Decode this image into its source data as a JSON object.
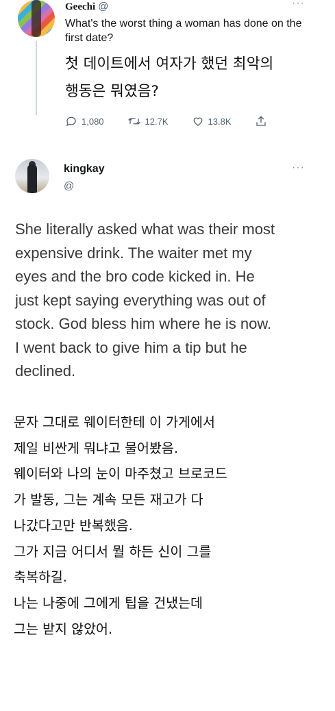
{
  "tweet1": {
    "name": "Geechi",
    "handle": "@",
    "more": "···",
    "text_en": "What's the worst thing a woman has done on the first date?",
    "text_ko_lines": [
      "첫 데이트에서 여자가 했던 최악의",
      "행동은 뭐였음?"
    ],
    "stats": {
      "replies": "1,080",
      "retweets": "12.7K",
      "likes": "13.8K"
    },
    "icons": [
      "reply-icon",
      "retweet-icon",
      "like-icon",
      "share-icon"
    ]
  },
  "tweet2": {
    "name": "kingkay",
    "handle": "@",
    "more": "···",
    "text_en_lines": [
      "She literally asked what was their most",
      "expensive drink. The waiter met my",
      "eyes and the bro code kicked in. He",
      "just kept saying everything was out of",
      "stock. God bless him where he is now.",
      "I went back to give him a tip but he",
      "declined."
    ]
  },
  "translation": {
    "lines": [
      "문자 그대로 웨이터한테 이 가게에서",
      "제일 비싼게 뭐냐고 물어봤음.",
      "웨이터와 나의 눈이 마주쳤고 브로코드",
      "가 발동, 그는 계속 모든 재고가 다",
      "나갔다고만 반복했음.",
      "그가 지금 어디서 뭘 하든 신이 그를",
      "축복하길.",
      "나는 나중에 그에게 팁을 건냈는데",
      "그는 받지 않았어."
    ]
  },
  "colors": {
    "text": "#14171a",
    "muted": "#536471",
    "thread": "#cfd9de"
  }
}
